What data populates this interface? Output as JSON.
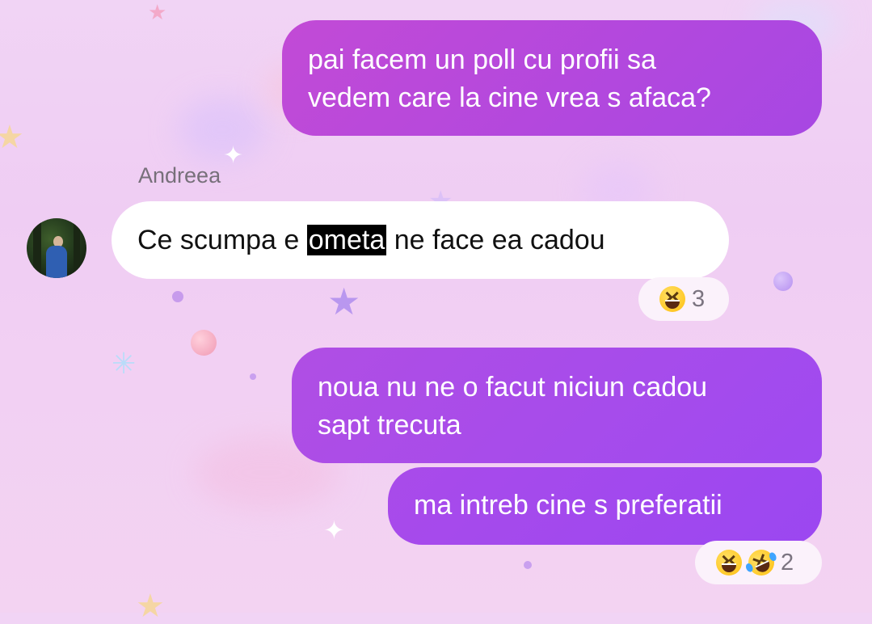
{
  "messages": [
    {
      "id": "m1",
      "direction": "outgoing",
      "lines": [
        "pai facem un poll cu profii sa",
        "vedem care la cine vrea s afaca?"
      ]
    },
    {
      "id": "m2",
      "direction": "incoming",
      "sender": "Andreea",
      "text_before": "Ce scumpa e ",
      "text_highlighted": "ometa",
      "text_after": " ne face ea cadou",
      "reactions": {
        "emojis": [
          "grinning-squinting-face-icon"
        ],
        "count": "3"
      }
    },
    {
      "id": "m3",
      "direction": "outgoing",
      "lines": [
        "noua nu ne o facut niciun cadou",
        "sapt trecuta"
      ]
    },
    {
      "id": "m4",
      "direction": "outgoing",
      "lines": [
        "ma intreb cine s preferatii"
      ],
      "reactions": {
        "emojis": [
          "grinning-squinting-face-icon",
          "rolling-on-floor-laughing-icon"
        ],
        "count": "2"
      }
    }
  ],
  "colors": {
    "outgoing_bubble": "#b448dc",
    "incoming_bubble": "#ffffff",
    "background": "#efd0f4",
    "highlight": "#000000"
  }
}
